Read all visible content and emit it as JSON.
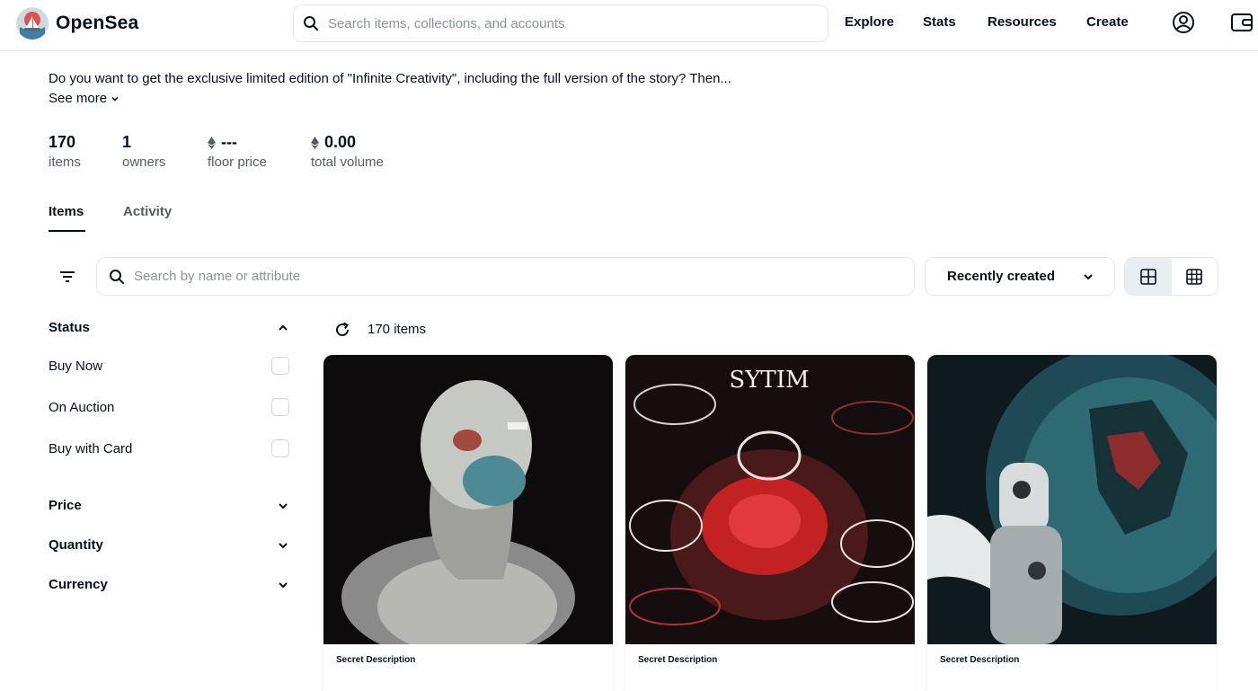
{
  "header": {
    "brand": "OpenSea",
    "search_placeholder": "Search items, collections, and accounts",
    "nav": [
      "Explore",
      "Stats",
      "Resources",
      "Create"
    ],
    "icons": [
      "account-icon",
      "wallet-icon"
    ]
  },
  "collection": {
    "description": "Do you want to get the exclusive limited edition of \"Infinite Creativity\", including the full version of the story? Then...",
    "see_more": "See more",
    "stats": [
      {
        "value": "170",
        "label": "items",
        "eth": false
      },
      {
        "value": "1",
        "label": "owners",
        "eth": false
      },
      {
        "value": "---",
        "label": "floor price",
        "eth": true
      },
      {
        "value": "0.00",
        "label": "total volume",
        "eth": true
      }
    ]
  },
  "tabs": [
    "Items",
    "Activity"
  ],
  "toolbar": {
    "search_placeholder": "Search by name or attribute",
    "sort_label": "Recently created"
  },
  "sidebar": {
    "status_title": "Status",
    "status_options": [
      "Buy Now",
      "On Auction",
      "Buy with Card"
    ],
    "sections": [
      "Price",
      "Quantity",
      "Currency"
    ]
  },
  "results": {
    "count_label": "170 items",
    "cards": [
      {
        "title": "Secret Description"
      },
      {
        "title": "Secret Description",
        "art_text": "SYTIM"
      },
      {
        "title": "Secret Description"
      }
    ]
  },
  "colors": {
    "text": "#04111d",
    "muted": "#545d66",
    "border": "#e5e8eb",
    "brand_blue": "#2081e2"
  }
}
